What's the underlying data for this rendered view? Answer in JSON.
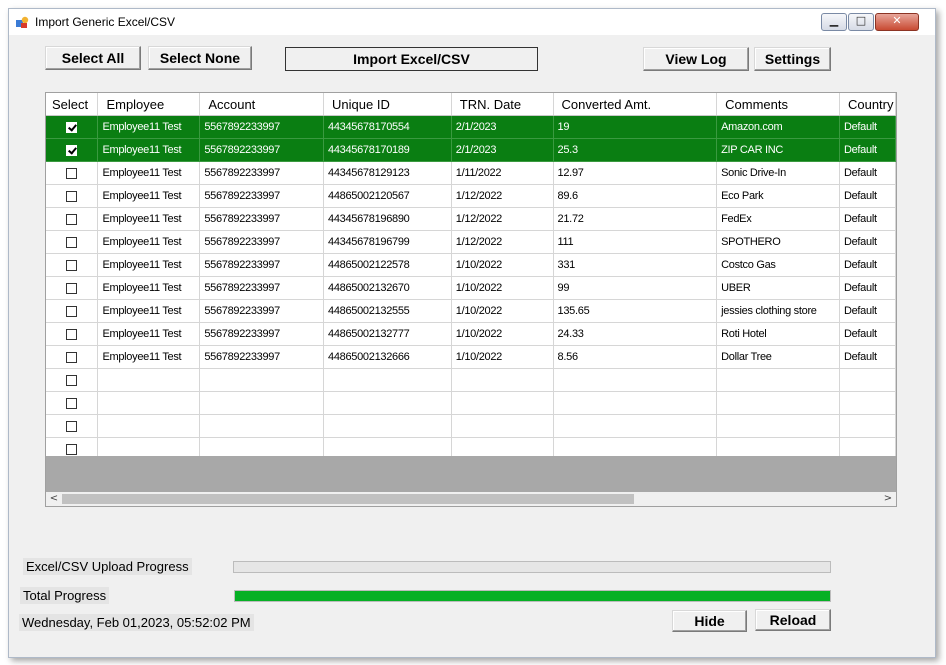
{
  "window": {
    "title": "Import Generic Excel/CSV"
  },
  "toolbar": {
    "select_all": "Select All",
    "select_none": "Select None",
    "import": "Import Excel/CSV",
    "view_log": "View Log",
    "settings": "Settings"
  },
  "grid": {
    "columns": [
      "Select",
      "Employee",
      "Account",
      "Unique ID",
      "TRN. Date",
      "Converted Amt.",
      "Comments",
      "Country"
    ],
    "rows": [
      {
        "checked": true,
        "employee": "Employee11 Test",
        "account": "5567892233997",
        "unique_id": "44345678170554",
        "date": "2/1/2023",
        "amount": "19",
        "comments": "Amazon.com",
        "country": "Default"
      },
      {
        "checked": true,
        "employee": "Employee11 Test",
        "account": "5567892233997",
        "unique_id": "44345678170189",
        "date": "2/1/2023",
        "amount": "25.3",
        "comments": "ZIP CAR INC",
        "country": "Default"
      },
      {
        "checked": false,
        "employee": "Employee11 Test",
        "account": "5567892233997",
        "unique_id": "44345678129123",
        "date": "1/11/2022",
        "amount": "12.97",
        "comments": "Sonic Drive-In",
        "country": "Default"
      },
      {
        "checked": false,
        "employee": "Employee11 Test",
        "account": "5567892233997",
        "unique_id": "44865002120567",
        "date": "1/12/2022",
        "amount": "89.6",
        "comments": "Eco Park",
        "country": "Default"
      },
      {
        "checked": false,
        "employee": "Employee11 Test",
        "account": "5567892233997",
        "unique_id": "44345678196890",
        "date": "1/12/2022",
        "amount": "21.72",
        "comments": "FedEx",
        "country": "Default"
      },
      {
        "checked": false,
        "employee": "Employee11 Test",
        "account": "5567892233997",
        "unique_id": "44345678196799",
        "date": "1/12/2022",
        "amount": "111",
        "comments": "SPOTHERO",
        "country": "Default"
      },
      {
        "checked": false,
        "employee": "Employee11 Test",
        "account": "5567892233997",
        "unique_id": "44865002122578",
        "date": "1/10/2022",
        "amount": "331",
        "comments": "Costco Gas",
        "country": "Default"
      },
      {
        "checked": false,
        "employee": "Employee11 Test",
        "account": "5567892233997",
        "unique_id": "44865002132670",
        "date": "1/10/2022",
        "amount": "99",
        "comments": "UBER",
        "country": "Default"
      },
      {
        "checked": false,
        "employee": "Employee11 Test",
        "account": "5567892233997",
        "unique_id": "44865002132555",
        "date": "1/10/2022",
        "amount": "135.65",
        "comments": "jessies clothing store",
        "country": "Default"
      },
      {
        "checked": false,
        "employee": "Employee11 Test",
        "account": "5567892233997",
        "unique_id": "44865002132777",
        "date": "1/10/2022",
        "amount": "24.33",
        "comments": "Roti Hotel",
        "country": "Default"
      },
      {
        "checked": false,
        "employee": "Employee11 Test",
        "account": "5567892233997",
        "unique_id": "44865002132666",
        "date": "1/10/2022",
        "amount": "8.56",
        "comments": "Dollar Tree",
        "country": "Default"
      },
      {
        "checked": false,
        "employee": "",
        "account": "",
        "unique_id": "",
        "date": "",
        "amount": "",
        "comments": "",
        "country": ""
      },
      {
        "checked": false,
        "employee": "",
        "account": "",
        "unique_id": "",
        "date": "",
        "amount": "",
        "comments": "",
        "country": ""
      },
      {
        "checked": false,
        "employee": "",
        "account": "",
        "unique_id": "",
        "date": "",
        "amount": "",
        "comments": "",
        "country": ""
      },
      {
        "checked": false,
        "employee": "",
        "account": "",
        "unique_id": "",
        "date": "",
        "amount": "",
        "comments": "",
        "country": ""
      }
    ]
  },
  "progress": {
    "upload_label": "Excel/CSV Upload Progress",
    "upload_value": 0,
    "total_label": "Total Progress",
    "total_value": 100,
    "bar_color": "#06b025"
  },
  "footer": {
    "timestamp": "Wednesday, Feb 01,2023, 05:52:02 PM",
    "hide": "Hide",
    "reload": "Reload"
  },
  "colors": {
    "selected_row": "#0a7e12"
  },
  "icons": {
    "app": "excel-import-app-icon",
    "scroll_left": "chevron-left-icon",
    "scroll_right": "chevron-right-icon"
  }
}
